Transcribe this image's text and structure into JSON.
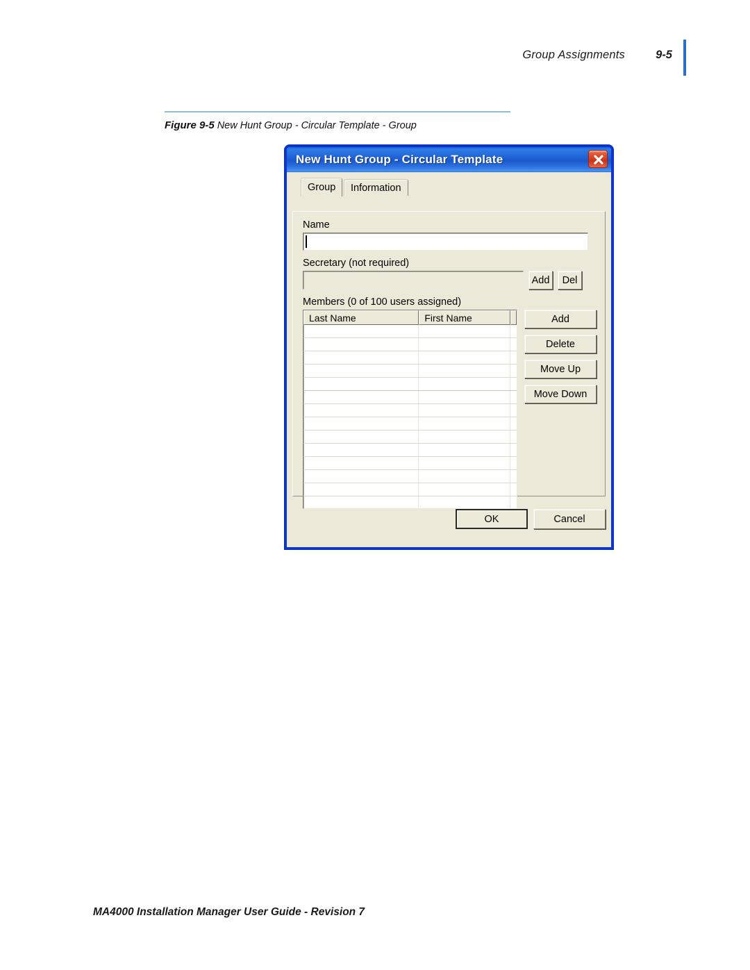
{
  "page": {
    "header_title": "Group Assignments",
    "header_page_number": "9-5",
    "footer_text": "MA4000 Installation Manager User Guide - Revision 7",
    "accent_rule_color": "#2d6fc4",
    "figure_rule_color": "#8fbdd9"
  },
  "figure": {
    "number": "Figure 9-5",
    "caption": "New Hunt Group - Circular Template - Group"
  },
  "dialog": {
    "title": "New Hunt Group - Circular Template",
    "title_bar_color": "#2063d6",
    "body_color": "#ece9d8",
    "border_color": "#0a36d8",
    "close_icon": "close-icon",
    "tabs": [
      {
        "label": "Group",
        "active": true
      },
      {
        "label": "Information",
        "active": false
      }
    ],
    "name": {
      "label": "Name",
      "value": "",
      "caret_visible": true
    },
    "secretary": {
      "label": "Secretary (not required)",
      "value": "",
      "disabled": true,
      "add_label": "Add",
      "del_label": "Del"
    },
    "members": {
      "label": "Members (0 of 100 users assigned)",
      "assigned_count": 0,
      "max_users": 100,
      "columns": [
        "Last Name",
        "First Name"
      ],
      "rows": [],
      "empty_row_count": 14,
      "buttons": [
        {
          "label": "Add"
        },
        {
          "label": "Delete"
        },
        {
          "label": "Move Up"
        },
        {
          "label": "Move Down"
        }
      ]
    },
    "footer_buttons": {
      "ok_label": "OK",
      "cancel_label": "Cancel"
    }
  }
}
